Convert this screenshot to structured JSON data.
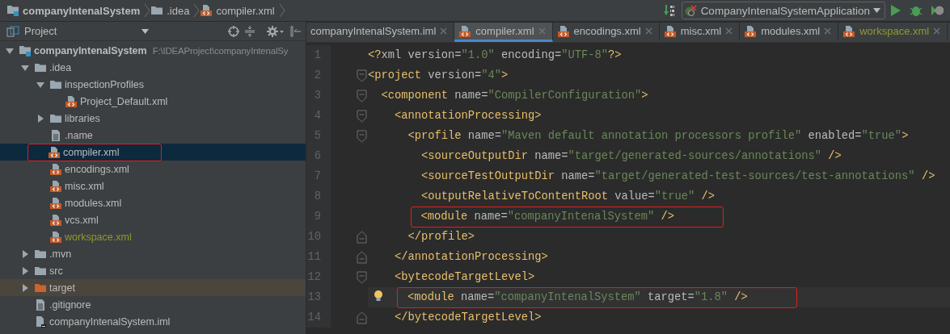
{
  "toolbar": {
    "breadcrumbs": [
      {
        "label": "companyIntenalSystem",
        "kind": "project"
      },
      {
        "label": ".idea",
        "kind": "folder"
      },
      {
        "label": "compiler.xml",
        "kind": "xml"
      }
    ],
    "run_config": {
      "label": "CompanyIntenalSystemApplication"
    }
  },
  "project_panel": {
    "title": "Project",
    "tree": [
      {
        "label": "companyIntenalSystem",
        "path": "F:\\IDEAProject\\companyIntenalSy",
        "kind": "project",
        "expanded": true,
        "selected": false,
        "highlighted": false,
        "color": "#bbbbbb",
        "children": [
          {
            "label": ".idea",
            "kind": "folder",
            "expanded": true,
            "selected": false,
            "highlighted": false,
            "color": "#bbbbbb",
            "children": [
              {
                "label": "inspectionProfiles",
                "kind": "folder",
                "expanded": true,
                "selected": false,
                "highlighted": false,
                "color": "#bbbbbb",
                "children": [
                  {
                    "label": "Project_Default.xml",
                    "kind": "xml",
                    "selected": false,
                    "highlighted": false,
                    "color": "#bbbbbb"
                  }
                ]
              },
              {
                "label": "libraries",
                "kind": "folder",
                "expanded": false,
                "selected": false,
                "highlighted": false,
                "color": "#bbbbbb"
              },
              {
                "label": ".name",
                "kind": "text",
                "selected": false,
                "highlighted": false,
                "color": "#bbbbbb"
              },
              {
                "label": "compiler.xml",
                "kind": "xml",
                "selected": true,
                "highlighted": true,
                "color": "#bbbbbb"
              },
              {
                "label": "encodings.xml",
                "kind": "xml",
                "selected": false,
                "highlighted": false,
                "color": "#bbbbbb"
              },
              {
                "label": "misc.xml",
                "kind": "xml",
                "selected": false,
                "highlighted": false,
                "color": "#bbbbbb"
              },
              {
                "label": "modules.xml",
                "kind": "xml",
                "selected": false,
                "highlighted": false,
                "color": "#bbbbbb"
              },
              {
                "label": "vcs.xml",
                "kind": "xml",
                "selected": false,
                "highlighted": false,
                "color": "#bbbbbb"
              },
              {
                "label": "workspace.xml",
                "kind": "xml",
                "selected": false,
                "highlighted": false,
                "color": "#8f9a2e"
              }
            ]
          },
          {
            "label": ".mvn",
            "kind": "folder",
            "expanded": false,
            "selected": false,
            "highlighted": false,
            "color": "#bbbbbb"
          },
          {
            "label": "src",
            "kind": "folder",
            "expanded": false,
            "selected": false,
            "highlighted": false,
            "color": "#bbbbbb"
          },
          {
            "label": "target",
            "kind": "excluded-folder",
            "expanded": false,
            "selected": false,
            "highlighted": false,
            "color": "#bbbbbb"
          },
          {
            "label": ".gitignore",
            "kind": "text",
            "selected": false,
            "highlighted": false,
            "color": "#bbbbbb"
          },
          {
            "label": "companyIntenalSystem.iml",
            "kind": "iml",
            "selected": false,
            "highlighted": false,
            "color": "#bbbbbb"
          }
        ]
      }
    ]
  },
  "editor": {
    "tabs": [
      {
        "label": "companyIntenalSystem.iml",
        "kind": "none",
        "selected": false,
        "color": "#bbbbbb"
      },
      {
        "label": "compiler.xml",
        "kind": "xml",
        "selected": true,
        "color": "#bbbbbb"
      },
      {
        "label": "encodings.xml",
        "kind": "xml",
        "selected": false,
        "color": "#bbbbbb"
      },
      {
        "label": "misc.xml",
        "kind": "xml",
        "selected": false,
        "color": "#bbbbbb"
      },
      {
        "label": "modules.xml",
        "kind": "xml",
        "selected": false,
        "color": "#bbbbbb"
      },
      {
        "label": "workspace.xml",
        "kind": "xml",
        "selected": false,
        "color": "#8f9a2e"
      }
    ],
    "lines": [
      {
        "number": "1",
        "fold_start": false,
        "fold_end": false,
        "highlighted": false,
        "current": false,
        "tokens": [
          {
            "kind": "tag",
            "text": "<?"
          },
          {
            "kind": "attr",
            "text": "xml version="
          },
          {
            "kind": "value",
            "text": "\"1.0\""
          },
          {
            "kind": "attr",
            "text": " encoding="
          },
          {
            "kind": "value",
            "text": "\"UTF-8\""
          },
          {
            "kind": "tag",
            "text": "?>"
          }
        ]
      },
      {
        "number": "2",
        "fold_start": true,
        "fold_end": false,
        "highlighted": false,
        "current": false,
        "tokens": [
          {
            "kind": "tag",
            "text": "<project"
          },
          {
            "kind": "attr",
            "text": " version="
          },
          {
            "kind": "value",
            "text": "\"4\""
          },
          {
            "kind": "tag",
            "text": ">"
          }
        ]
      },
      {
        "number": "3",
        "fold_start": true,
        "fold_end": false,
        "highlighted": false,
        "current": false,
        "tokens": [
          {
            "kind": "tag",
            "text": "  <component"
          },
          {
            "kind": "attr",
            "text": " name="
          },
          {
            "kind": "value",
            "text": "\"CompilerConfiguration\""
          },
          {
            "kind": "tag",
            "text": ">"
          }
        ]
      },
      {
        "number": "4",
        "fold_start": true,
        "fold_end": false,
        "highlighted": false,
        "current": false,
        "tokens": [
          {
            "kind": "tag",
            "text": "    <annotationProcessing>"
          }
        ]
      },
      {
        "number": "5",
        "fold_start": true,
        "fold_end": false,
        "highlighted": false,
        "current": false,
        "tokens": [
          {
            "kind": "tag",
            "text": "      <profile"
          },
          {
            "kind": "attr",
            "text": " name="
          },
          {
            "kind": "value",
            "text": "\"Maven default annotation processors profile\""
          },
          {
            "kind": "attr",
            "text": " enabled="
          },
          {
            "kind": "value",
            "text": "\"true\""
          },
          {
            "kind": "tag",
            "text": ">"
          }
        ]
      },
      {
        "number": "6",
        "fold_start": false,
        "fold_end": false,
        "highlighted": false,
        "current": false,
        "tokens": [
          {
            "kind": "tag",
            "text": "        <sourceOutputDir"
          },
          {
            "kind": "attr",
            "text": " name="
          },
          {
            "kind": "value",
            "text": "\"target/generated-sources/annotations\""
          },
          {
            "kind": "tag",
            "text": " />"
          }
        ]
      },
      {
        "number": "7",
        "fold_start": false,
        "fold_end": false,
        "highlighted": false,
        "current": false,
        "tokens": [
          {
            "kind": "tag",
            "text": "        <sourceTestOutputDir"
          },
          {
            "kind": "attr",
            "text": " name="
          },
          {
            "kind": "value",
            "text": "\"target/generated-test-sources/test-annotations\""
          },
          {
            "kind": "tag",
            "text": " />"
          }
        ]
      },
      {
        "number": "8",
        "fold_start": false,
        "fold_end": false,
        "highlighted": false,
        "current": false,
        "tokens": [
          {
            "kind": "tag",
            "text": "        <outputRelativeToContentRoot"
          },
          {
            "kind": "attr",
            "text": " value="
          },
          {
            "kind": "value",
            "text": "\"true\""
          },
          {
            "kind": "tag",
            "text": " />"
          }
        ]
      },
      {
        "number": "9",
        "fold_start": false,
        "fold_end": false,
        "highlighted": true,
        "current": false,
        "tokens": [
          {
            "kind": "tag",
            "text": "        <module"
          },
          {
            "kind": "attr",
            "text": " name="
          },
          {
            "kind": "value",
            "text": "\"companyIntenalSystem\""
          },
          {
            "kind": "tag",
            "text": " />"
          }
        ]
      },
      {
        "number": "10",
        "fold_start": false,
        "fold_end": true,
        "highlighted": false,
        "current": false,
        "tokens": [
          {
            "kind": "tag",
            "text": "      </profile>"
          }
        ]
      },
      {
        "number": "11",
        "fold_start": false,
        "fold_end": true,
        "highlighted": false,
        "current": false,
        "tokens": [
          {
            "kind": "tag",
            "text": "    </annotationProcessing>"
          }
        ]
      },
      {
        "number": "12",
        "fold_start": true,
        "fold_end": false,
        "highlighted": false,
        "current": false,
        "tokens": [
          {
            "kind": "tag",
            "text": "    <bytecodeTargetLevel>"
          }
        ]
      },
      {
        "number": "13",
        "fold_start": false,
        "fold_end": false,
        "highlighted": true,
        "current": true,
        "tokens": [
          {
            "kind": "tag",
            "text": "      <module"
          },
          {
            "kind": "attr",
            "text": " name="
          },
          {
            "kind": "value",
            "text": "\"companyIntenalSystem\""
          },
          {
            "kind": "attr",
            "text": " target="
          },
          {
            "kind": "value",
            "text": "\"1.8\""
          },
          {
            "kind": "tag",
            "text": " />"
          }
        ]
      },
      {
        "number": "14",
        "fold_start": false,
        "fold_end": true,
        "highlighted": false,
        "current": false,
        "tokens": [
          {
            "kind": "tag",
            "text": "    </bytecodeTargetLevel>"
          }
        ]
      }
    ]
  }
}
